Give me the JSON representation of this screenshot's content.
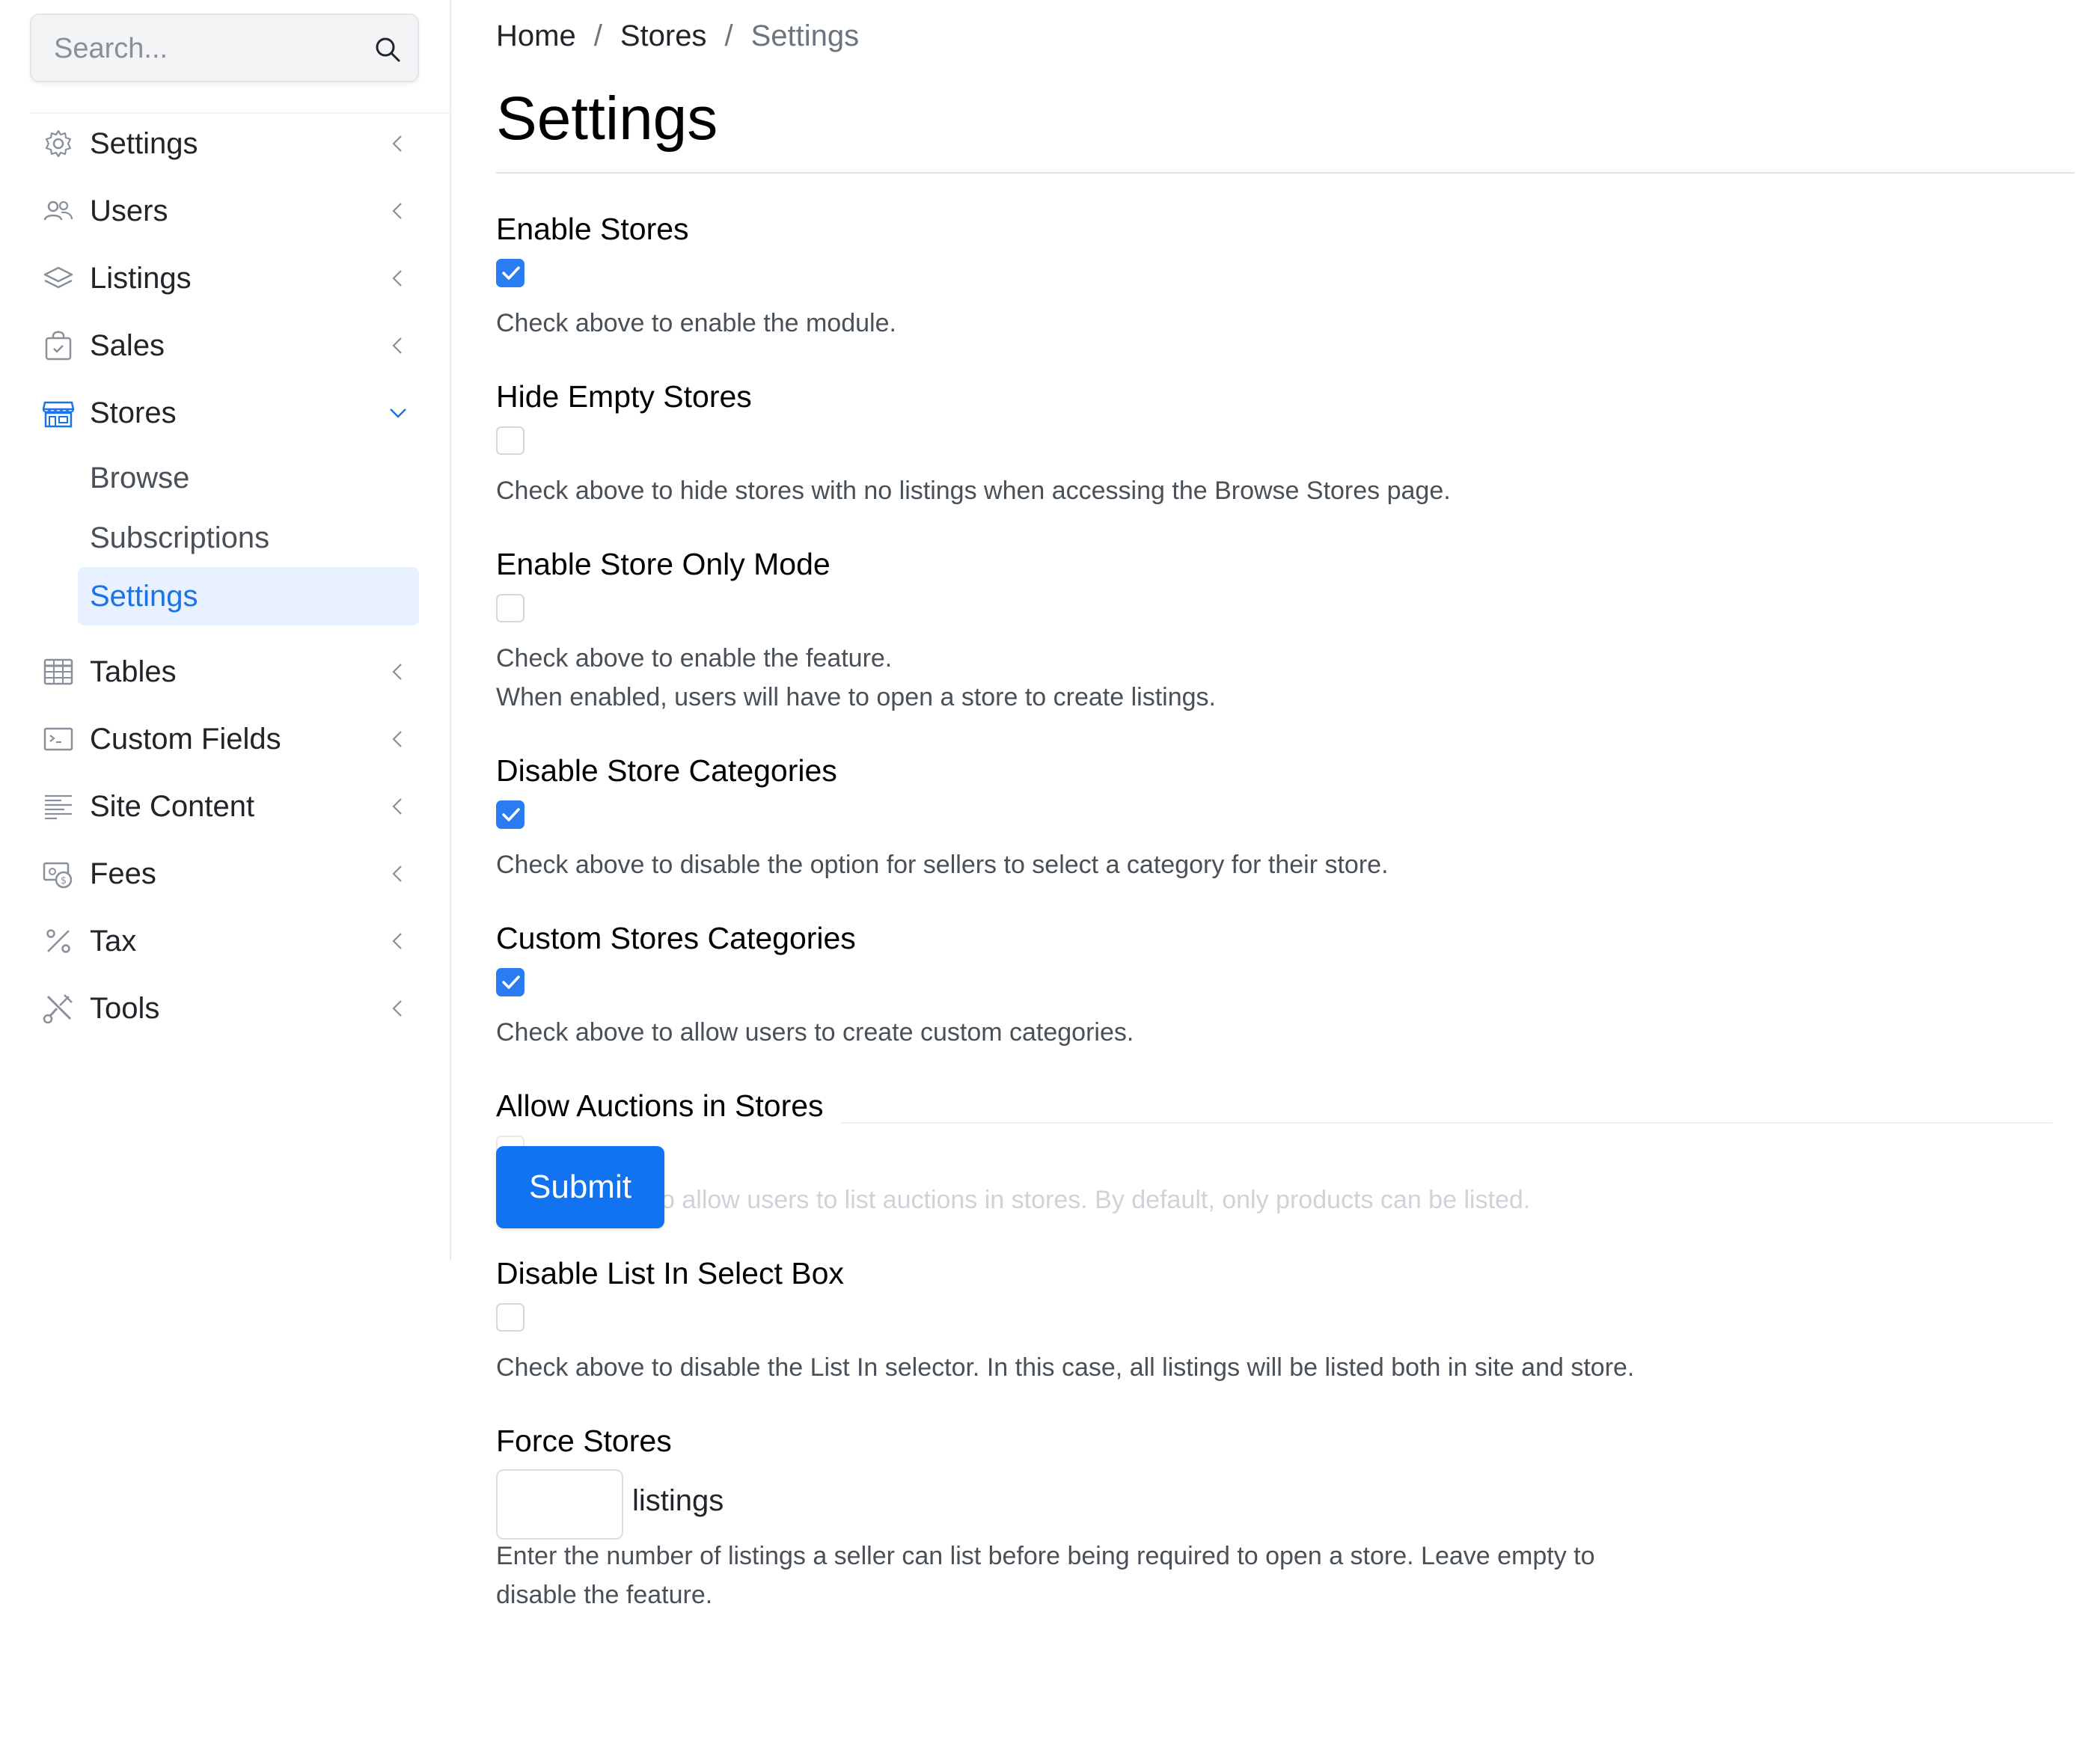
{
  "search": {
    "placeholder": "Search..."
  },
  "sidebar": {
    "items": [
      {
        "label": "Settings",
        "icon": "gear-icon"
      },
      {
        "label": "Users",
        "icon": "users-icon"
      },
      {
        "label": "Listings",
        "icon": "layers-icon"
      },
      {
        "label": "Sales",
        "icon": "bag-icon"
      },
      {
        "label": "Stores",
        "icon": "store-icon",
        "expanded": true
      },
      {
        "label": "Tables",
        "icon": "table-icon"
      },
      {
        "label": "Custom Fields",
        "icon": "terminal-icon"
      },
      {
        "label": "Site Content",
        "icon": "text-lines-icon"
      },
      {
        "label": "Fees",
        "icon": "fees-icon"
      },
      {
        "label": "Tax",
        "icon": "percent-icon"
      },
      {
        "label": "Tools",
        "icon": "tools-icon"
      }
    ],
    "stores_sub": [
      {
        "label": "Browse"
      },
      {
        "label": "Subscriptions"
      },
      {
        "label": "Settings",
        "active": true
      }
    ],
    "active_color": "#1a73e8"
  },
  "breadcrumb": {
    "home": "Home",
    "stores": "Stores",
    "current": "Settings",
    "separator": "/"
  },
  "page": {
    "title": "Settings"
  },
  "fields": [
    {
      "label": "Enable Stores",
      "checked": true,
      "help": [
        "Check above to enable the module."
      ]
    },
    {
      "label": "Hide Empty Stores",
      "checked": false,
      "help": [
        "Check above to hide stores with no listings when accessing the Browse Stores page."
      ]
    },
    {
      "label": "Enable Store Only Mode",
      "checked": false,
      "help": [
        "Check above to enable the feature.",
        "When enabled, users will have to open a store to create listings."
      ]
    },
    {
      "label": "Disable Store Categories",
      "checked": true,
      "help": [
        "Check above to disable the option for sellers to select a category for their store."
      ]
    },
    {
      "label": "Custom Stores Categories",
      "checked": true,
      "help": [
        "Check above to allow users to create custom categories."
      ]
    },
    {
      "label": "Allow Auctions in Stores",
      "checked": false,
      "help": [
        "o allow users to list auctions in stores. By default, only products can be listed."
      ]
    },
    {
      "label": "Disable List In Select Box",
      "checked": false,
      "help": [
        "Check above to disable the List In selector. In this case, all listings will be listed both in site and store."
      ]
    },
    {
      "label": "Force Stores",
      "value": "",
      "suffix": "listings",
      "help": [
        "Enter the number of listings a seller can list before being required to open a store. Leave empty to",
        "disable the feature."
      ]
    }
  ],
  "submit": {
    "label": "Submit",
    "color": "#1273f0"
  },
  "checkbox_color": "#2b7bf3"
}
